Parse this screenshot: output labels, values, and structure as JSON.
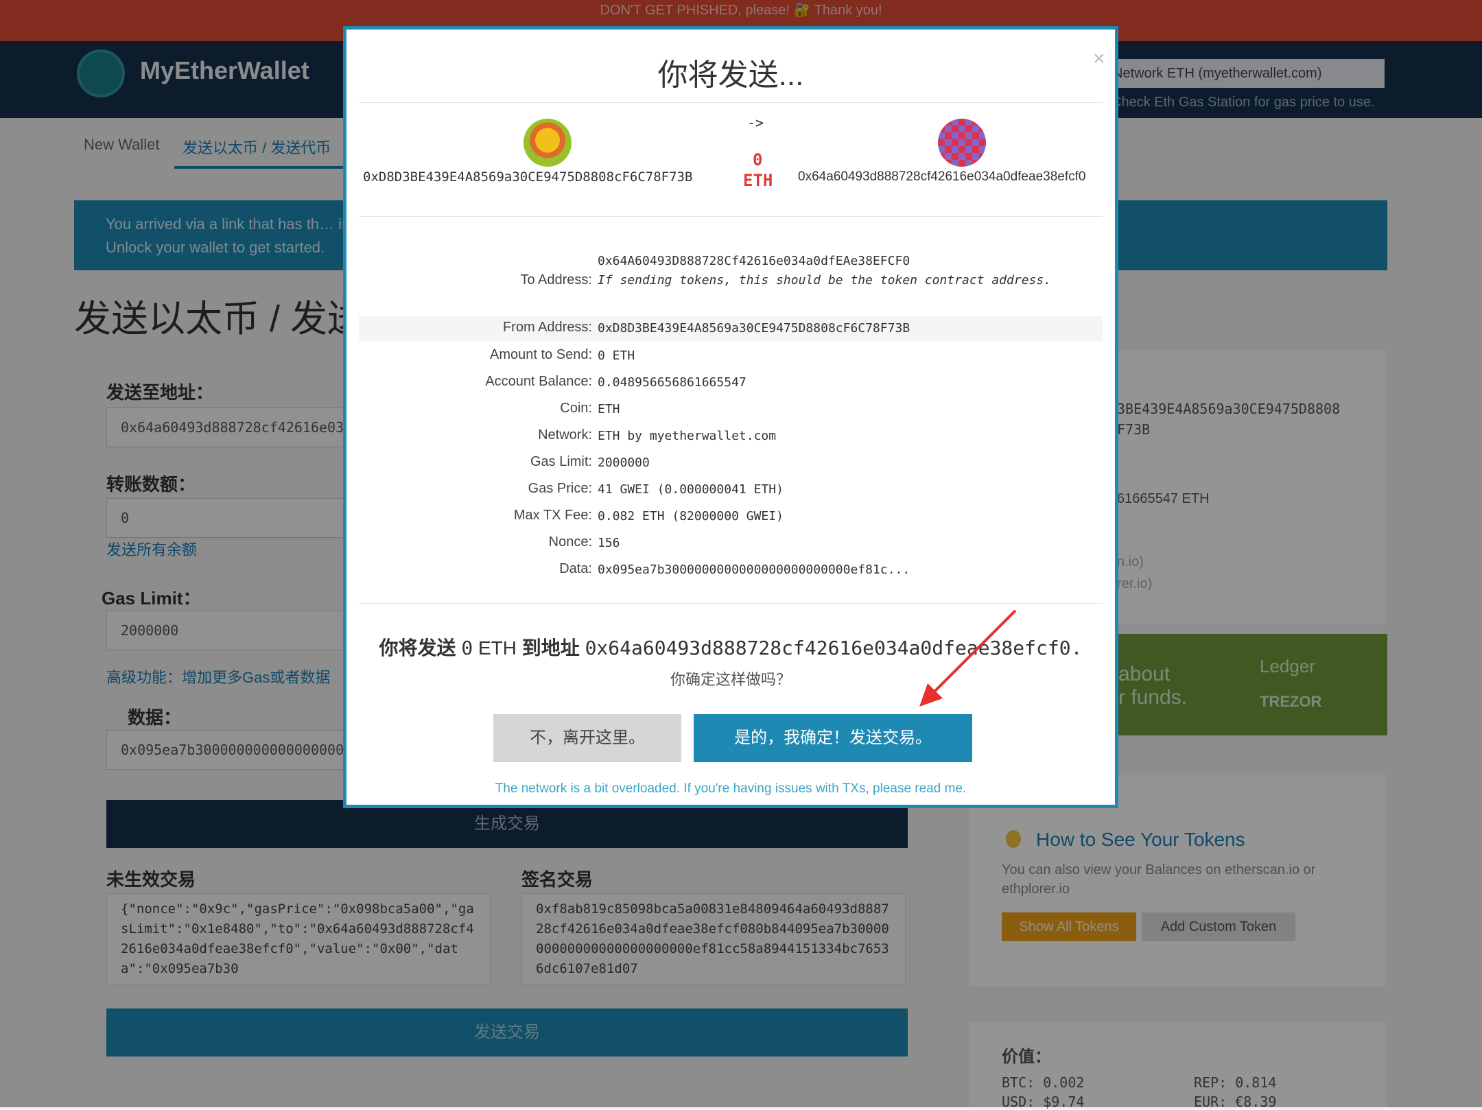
{
  "warning_bar": "DON'T GET PHISHED, please! 🔐 Thank you!",
  "app": {
    "name": "MyEtherWallet"
  },
  "header": {
    "network": "Network ETH (myetherwallet.com)",
    "gas_link": "Check Eth Gas Station for gas price to use."
  },
  "nav": {
    "new_wallet": "New Wallet",
    "send": "发送以太币 / 发送代币"
  },
  "banner": {
    "line1": "You arrived via a link that has th… information before sending.",
    "line2": "Unlock your wallet to get started."
  },
  "page_title": "发送以太币 / 发送代币",
  "form": {
    "to_label": "发送至地址：",
    "to_value": "0x64a60493d888728cf42616e034a0dfeae38efcf0",
    "amount_label": "转账数额：",
    "amount_value": "0",
    "send_all": "发送所有余额",
    "gas_limit_label": "Gas Limit：",
    "gas_limit_value": "2000000",
    "advanced_link": "高级功能：增加更多Gas或者数据",
    "data_label": "数据：",
    "data_value": "0x095ea7b3000000000000000000000000",
    "generate_btn": "生成交易",
    "raw_label": "未生效交易",
    "raw_tx": "{\"nonce\":\"0x9c\",\"gasPrice\":\"0x098bca5a00\",\"gasLimit\":\"0x1e8480\",\"to\":\"0x64a60493d888728cf42616e034a0dfeae38efcf0\",\"value\":\"0x00\",\"data\":\"0x095ea7b30",
    "signed_label": "签名交易",
    "signed_tx": "0xf8ab819c85098bca5a00831e84809464a60493d888728cf42616e034a0dfeae38efcf080b844095ea7b3000000000000000000000000ef81cc58a8944151334bc76536dc6107e81d07",
    "send_btn": "发送交易"
  },
  "right_panel": {
    "addr_partial_1": "3BE439E4A8569a30CE9475D8808",
    "addr_partial_2": "F73B",
    "balance_partial": "61665547 ETH",
    "link_partial_1": "n.io)",
    "link_partial_2": "rer.io)",
    "hw_text_1": "about",
    "hw_text_2": "r funds.",
    "hw_ledger": "Ledger",
    "hw_trezor": "TREZOR",
    "token_link": "How to See Your Tokens",
    "token_desc": "You can also view your Balances on etherscan.io or ethplorer.io",
    "show_tokens": "Show All Tokens",
    "add_token": "Add Custom Token",
    "price_title": "价值：",
    "btc": "BTC: 0.002",
    "usd": "USD: $9.74",
    "rep": "REP: 0.814",
    "eur": "EUR: €8.39"
  },
  "modal": {
    "title": "你将发送...",
    "close": "×",
    "from_address": "0xD8D3BE439E4A8569a30CE9475D8808cF6C78F73B",
    "to_address": "0x64a60493d888728cf42616e034a0dfeae38efcf0",
    "arrow": "->",
    "amount": "0",
    "unit": "ETH",
    "details": {
      "to_label": "To Address:",
      "to_value": "0x64A60493D888728Cf42616e034a0dfEAe38EFCF0",
      "to_note": "If sending tokens, this should be the token contract address.",
      "from_label": "From Address:",
      "from_value": "0xD8D3BE439E4A8569a30CE9475D8808cF6C78F73B",
      "amount_label": "Amount to Send:",
      "amount_value": "0 ETH",
      "balance_label": "Account Balance:",
      "balance_value": "0.048956656861665547",
      "coin_label": "Coin:",
      "coin_value": "ETH",
      "network_label": "Network:",
      "network_value": "ETH by myetherwallet.com",
      "gas_limit_label": "Gas Limit:",
      "gas_limit_value": "2000000",
      "gas_price_label": "Gas Price:",
      "gas_price_value": "41 GWEI (0.000000041 ETH)",
      "max_fee_label": "Max TX Fee:",
      "max_fee_value": "0.082 ETH (82000000 GWEI)",
      "nonce_label": "Nonce:",
      "nonce_value": "156",
      "data_label": "Data:",
      "data_value": "0x095ea7b3000000000000000000000000ef81c..."
    },
    "confirm_prefix": "你将发送",
    "confirm_amount": "0",
    "confirm_unit": "ETH",
    "confirm_mid": "到地址",
    "confirm_address": "0x64a60493d888728cf42616e034a0dfeae38efcf0.",
    "confirm_question": "你确定这样做吗？",
    "no_btn": "不，离开这里。",
    "yes_btn": "是的，我确定！发送交易。",
    "overload_note": "The network is a bit overloaded. If you're having issues with TXs, please read me."
  },
  "colors": {
    "accent": "#1e8ab3",
    "navy": "#17314f",
    "danger": "#e04a36"
  }
}
